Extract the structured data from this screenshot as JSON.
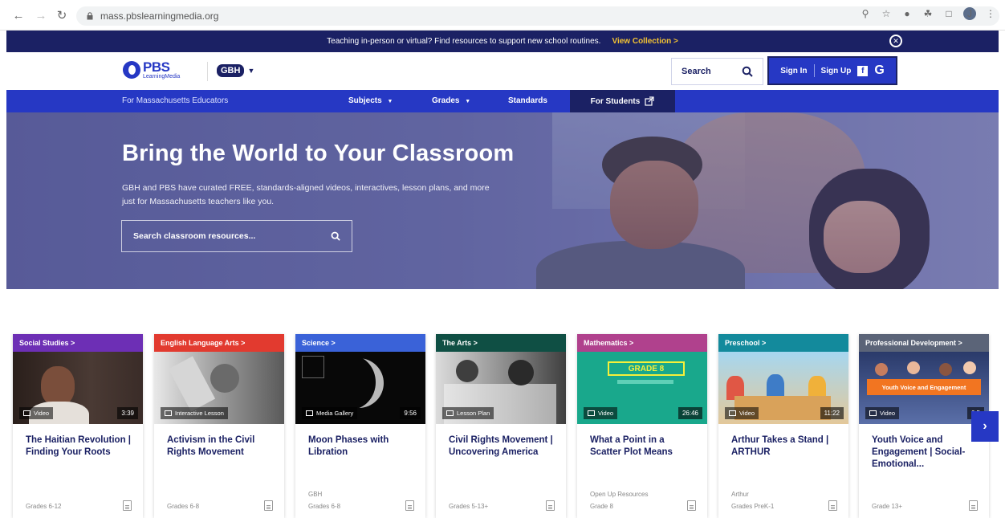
{
  "browser": {
    "url": "mass.pbslearningmedia.org"
  },
  "announcement": {
    "text": "Teaching in-person or virtual? Find resources to support new school routines.",
    "link": "View Collection >"
  },
  "header": {
    "logo_main": "PBS",
    "logo_sub": "LearningMedia",
    "partner": "GBH",
    "search_label": "Search",
    "sign_in": "Sign In",
    "sign_up": "Sign Up"
  },
  "nav": {
    "region": "For Massachusetts Educators",
    "subjects": "Subjects",
    "grades": "Grades",
    "standards": "Standards",
    "students": "For Students"
  },
  "hero": {
    "title": "Bring the World to Your Classroom",
    "description": "GBH and PBS have curated FREE, standards-aligned videos, interactives, lesson plans, and more just for Massachusetts teachers like you.",
    "search_placeholder": "Search classroom resources..."
  },
  "cards": [
    {
      "category": "Social Studies >",
      "color": "#6d2fb5",
      "type": "Video",
      "duration": "3:39",
      "title": "The Haitian Revolution | Finding Your Roots",
      "producer": "",
      "grade": "Grades 6-12"
    },
    {
      "category": "English Language Arts >",
      "color": "#e23a2f",
      "type": "Interactive Lesson",
      "duration": "",
      "title": "Activism in the Civil Rights Movement",
      "producer": "",
      "grade": "Grades 6-8"
    },
    {
      "category": "Science >",
      "color": "#3a62d8",
      "type": "Media Gallery",
      "duration": "9:56",
      "title": "Moon Phases with Libration",
      "producer": "GBH",
      "grade": "Grades 6-8"
    },
    {
      "category": "The Arts >",
      "color": "#0f4f44",
      "type": "Lesson Plan",
      "duration": "",
      "title": "Civil Rights Movement | Uncovering America",
      "producer": "",
      "grade": "Grades 5-13+"
    },
    {
      "category": "Mathematics >",
      "color": "#b0418d",
      "type": "Video",
      "duration": "26:46",
      "title": "What a Point in a Scatter Plot Means",
      "producer": "Open Up Resources",
      "grade": "Grade 8",
      "thumb_text": "GRADE 8"
    },
    {
      "category": "Preschool >",
      "color": "#138a9c",
      "type": "Video",
      "duration": "11:22",
      "title": "Arthur Takes a Stand | ARTHUR",
      "producer": "Arthur",
      "grade": "Grades PreK-1"
    },
    {
      "category": "Professional Development >",
      "color": "#5b6478",
      "type": "Video",
      "duration": "6:5",
      "title": "Youth Voice and Engagement | Social-Emotional...",
      "producer": "",
      "grade": "Grade 13+",
      "thumb_text": "Youth Voice and Engagement"
    }
  ]
}
